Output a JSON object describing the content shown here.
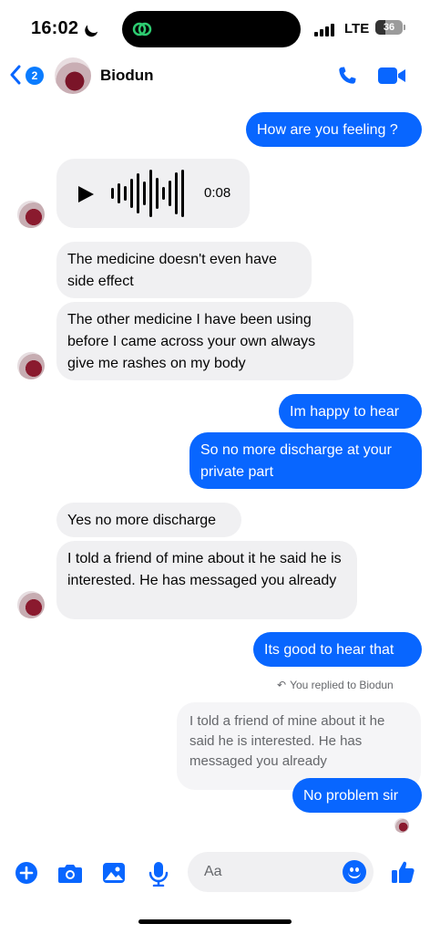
{
  "status_bar": {
    "time": "16:02",
    "network": "LTE",
    "battery": "36",
    "battery_level": 0.36
  },
  "header": {
    "back_count": "2",
    "contact_name": "Biodun"
  },
  "messages": {
    "m1": "How are you feeling ?",
    "voice_duration": "0:08",
    "m2": "The medicine doesn't even have side effect",
    "m3": "The other medicine I have been using before I came across your own always give me rashes on my body",
    "m4": "Im happy to hear",
    "m5": "So no more discharge at your private part",
    "m6": "Yes no more discharge",
    "m7": "I told a friend of mine about it he said he is interested. He has messaged you already",
    "m8": "Its good to hear that",
    "reply_note": "You replied to Biodun",
    "quoted": "I told a friend of mine about it he said he is interested. He has messaged you already",
    "m9": "No problem sir"
  },
  "composer": {
    "placeholder": "Aa"
  },
  "colors": {
    "accent": "#0866ff",
    "incoming_bubble": "#f0f0f2"
  },
  "icons": [
    "plus-icon",
    "camera-icon",
    "gallery-icon",
    "microphone-icon",
    "emoji-icon",
    "thumbs-up-icon",
    "phone-icon",
    "video-icon",
    "play-icon"
  ]
}
